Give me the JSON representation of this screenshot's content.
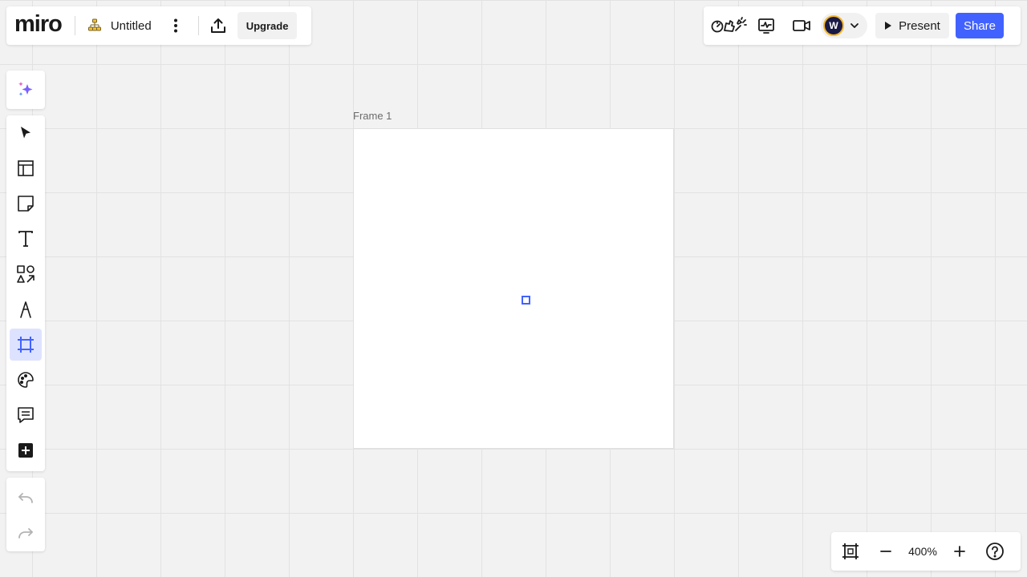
{
  "header": {
    "logo": "miro",
    "board_title": "Untitled",
    "upgrade_label": "Upgrade"
  },
  "topright": {
    "avatar_initial": "W",
    "present_label": "Present",
    "share_label": "Share"
  },
  "toolbar": {
    "tools": [
      {
        "name": "select",
        "icon": "cursor-icon"
      },
      {
        "name": "templates",
        "icon": "templates-icon"
      },
      {
        "name": "sticky-note",
        "icon": "sticky-note-icon"
      },
      {
        "name": "text",
        "icon": "text-icon"
      },
      {
        "name": "shapes",
        "icon": "shapes-icon"
      },
      {
        "name": "pen",
        "icon": "pen-icon"
      },
      {
        "name": "frame",
        "icon": "frame-icon",
        "active": true
      },
      {
        "name": "stickers",
        "icon": "sticker-icon"
      },
      {
        "name": "comment",
        "icon": "comment-icon"
      },
      {
        "name": "more-apps",
        "icon": "plus-square-icon"
      }
    ]
  },
  "canvas": {
    "frame_label": "Frame 1"
  },
  "zoom": {
    "level": "400%"
  },
  "colors": {
    "accent": "#4262ff",
    "active_tool_bg": "#dde3ff",
    "canvas_bg": "#f2f2f2",
    "avatar_ring": "#f5b82e"
  }
}
